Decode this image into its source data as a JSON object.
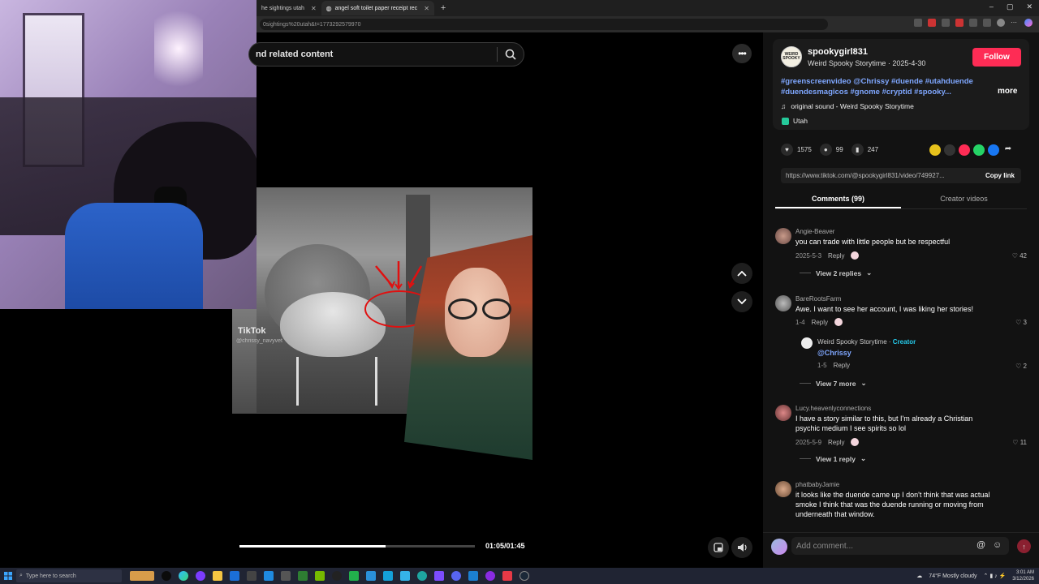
{
  "browser": {
    "tabs": [
      {
        "label": "he sightings utah",
        "active": false
      },
      {
        "label": "angel soft toilet paper receipt rec",
        "active": true
      }
    ],
    "url": "0sightings%20utah&t=1773292579970",
    "window_controls": [
      "–",
      "▢",
      "✕"
    ]
  },
  "search": {
    "text": "nd related content",
    "icon": "search-icon"
  },
  "video": {
    "watermark": "TikTok",
    "watermark_handle": "@chrissy_navyvet",
    "progress_fraction": 0.62,
    "time": "01:05/01:45",
    "colors": {
      "circle": "#e01010",
      "fill": "#ffffff",
      "track": "#444444"
    }
  },
  "author": {
    "avatar_text": "WEIRD SPOOKY",
    "username": "spookygirl831",
    "nickname": "Weird Spooky Storytime · 2025-4-30",
    "follow_label": "Follow",
    "description": "#greenscreenvideo @Chrissy #duende #utahduende #duendesmagicos #gnome #cryptid #spooky...",
    "more_label": "more",
    "sound": "original sound - Weird Spooky Storytime",
    "location": "Utah",
    "colors": {
      "follow": "#fe2c55",
      "hashtag": "#7fa7ff"
    }
  },
  "stats": {
    "likes": "1575",
    "comments": "99",
    "saves": "247"
  },
  "link": {
    "url": "https://www.tiktok.com/@spookygirl831/video/749927...",
    "copy_label": "Copy link"
  },
  "tabs": {
    "comments": "Comments (99)",
    "creator_videos": "Creator videos"
  },
  "comments": [
    {
      "user": "Angie-Beaver",
      "text": "you can trade with little people but be respectful",
      "date": "2025-5-3",
      "reply": "Reply",
      "likes": "42",
      "view_replies": "View 2 replies"
    },
    {
      "user": "BareRootsFarm",
      "text": "Awe. I want to see her account, I was liking her stories!",
      "date": "1-4",
      "reply": "Reply",
      "likes": "3"
    },
    {
      "user": "Weird Spooky Storytime",
      "creator_label": "Creator",
      "mention": "@Chrissy",
      "date": "1-5",
      "reply": "Reply",
      "likes": "2",
      "view_replies": "View 7 more"
    },
    {
      "user": "Lucy.heavenlyconnections",
      "text": "I have a story similar to this, but I'm already a Christian psychic medium I see spirits so lol",
      "date": "2025-5-9",
      "reply": "Reply",
      "likes": "11",
      "view_replies": "View 1 reply"
    },
    {
      "user": "phatbabyJamie",
      "text": "it looks like the duende came up I don't think that was actual smoke I think that was the duende running or moving from underneath that window."
    }
  ],
  "add_comment": {
    "placeholder": "Add comment..."
  },
  "taskbar": {
    "search_placeholder": "Type here to search",
    "weather": "74°F  Mostly cloudy",
    "time": "3:01 AM",
    "date": "3/12/2026"
  }
}
